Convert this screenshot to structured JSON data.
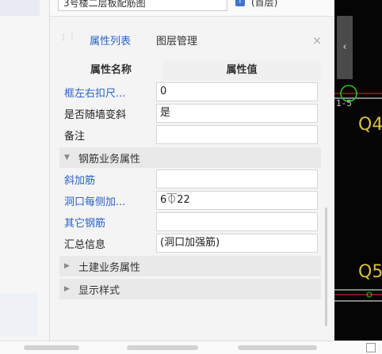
{
  "top_fragment": {
    "drawing_name": "3号楼二层板配筋图",
    "layer_label": "(首层)"
  },
  "tabs": {
    "properties": "属性列表",
    "layers": "图层管理",
    "close_symbol": "×"
  },
  "table": {
    "header_name": "属性名称",
    "header_value": "属性值",
    "rows": [
      {
        "label": "框左右扣尺...",
        "value": "0"
      },
      {
        "label": "是否随墙变斜",
        "value": "是"
      },
      {
        "label": "备注",
        "value": ""
      }
    ],
    "rebar_section": {
      "title": "钢筋业务属性",
      "rows": [
        {
          "label": "斜加筋",
          "value": ""
        },
        {
          "label": "洞口每侧加...",
          "value": "6⏁22"
        },
        {
          "label": "其它钢筋",
          "value": ""
        },
        {
          "label": "汇总信息",
          "value": "(洞口加强筋)"
        }
      ]
    },
    "civil_section": {
      "title": "土建业务属性"
    },
    "display_section": {
      "title": "显示样式"
    }
  },
  "canvas": {
    "labels": [
      "Q4",
      "Q5"
    ],
    "fragment": "1-5",
    "background": "#050505",
    "accent_green": "#22cc22",
    "accent_red": "#e03030"
  }
}
